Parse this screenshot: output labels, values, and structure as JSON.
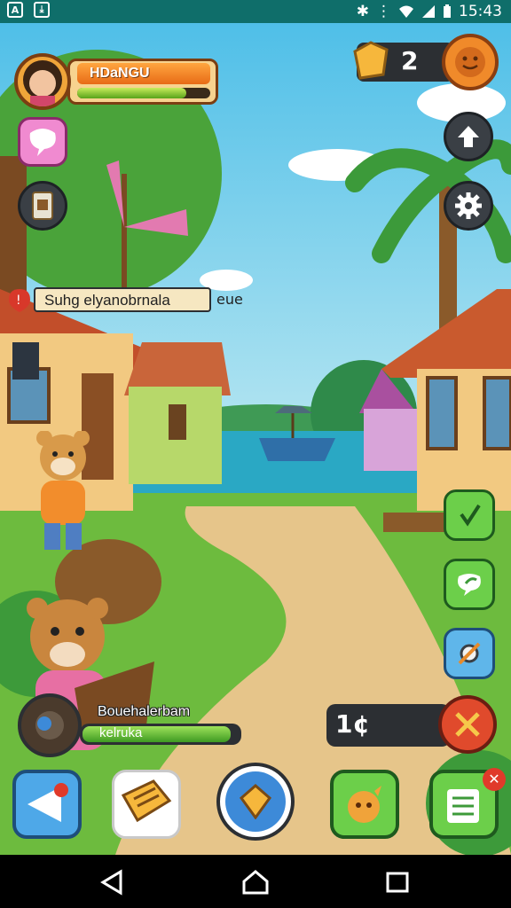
{
  "status_bar": {
    "time": "15:43",
    "left_icons": [
      "app-a-icon",
      "download-icon"
    ],
    "right_icons": [
      "bluetooth-icon",
      "vibrate-icon",
      "wifi-icon",
      "signal-icon",
      "battery-icon"
    ]
  },
  "player": {
    "name": "HDaNGU",
    "xp_fraction": 0.82
  },
  "currency": {
    "count": "2"
  },
  "quest_banner": {
    "text": "Suhg elyanobrnala",
    "suffix": "eue"
  },
  "companion": {
    "title": "Bouehalerbam",
    "subtitle": "kelruka",
    "progress_fraction": 0.95
  },
  "resource": {
    "count": "1¢"
  },
  "nav_bar": {
    "buttons": [
      "back-icon",
      "home-icon",
      "recents-icon"
    ]
  },
  "colors": {
    "sky_top": "#4fbfe8",
    "sea": "#2aa8c4",
    "grass": "#6dbb3e",
    "path": "#e6c58a",
    "accent_orange": "#f08a2a"
  }
}
